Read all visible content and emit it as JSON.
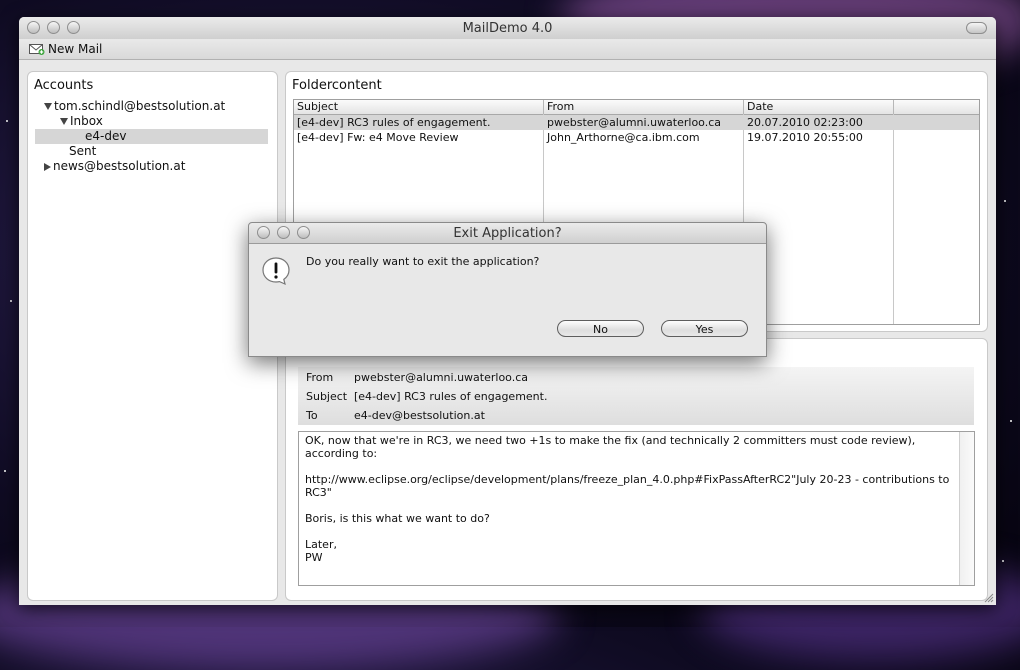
{
  "window": {
    "title": "MailDemo 4.0",
    "toolbar": {
      "new_mail_label": "New Mail",
      "new_mail_icon": "mail-add-icon"
    }
  },
  "accounts": {
    "title": "Accounts",
    "tree": [
      {
        "label": "tom.schindl@bestsolution.at",
        "expanded": true
      },
      {
        "label": "Inbox",
        "expanded": true
      },
      {
        "label": "e4-dev",
        "selected": true
      },
      {
        "label": "Sent"
      },
      {
        "label": "news@bestsolution.at",
        "expanded": false
      }
    ]
  },
  "foldercontent": {
    "title": "Foldercontent",
    "columns": [
      "Subject",
      "From",
      "Date"
    ],
    "rows": [
      {
        "subject": "[e4-dev] RC3 rules of engagement.",
        "from": "pwebster@alumni.uwaterloo.ca",
        "date": "20.07.2010 02:23:00",
        "selected": true
      },
      {
        "subject": "[e4-dev] Fw: e4 Move Review",
        "from": "John_Arthorne@ca.ibm.com",
        "date": "19.07.2010 20:55:00"
      }
    ]
  },
  "mail": {
    "from_label": "From",
    "from": "pwebster@alumni.uwaterloo.ca",
    "subject_label": "Subject",
    "subject": "[e4-dev] RC3 rules of engagement.",
    "to_label": "To",
    "to": "e4-dev@bestsolution.at",
    "body": "OK, now that we're in RC3, we need two +1s to make the fix (and technically 2 committers must code review), according to:\n\nhttp://www.eclipse.org/eclipse/development/plans/freeze_plan_4.0.php#FixPassAfterRC2\"July 20-23 - contributions to RC3\"\n\nBoris, is this what we want to do?\n\nLater,\nPW"
  },
  "dialog": {
    "title": "Exit Application?",
    "message": "Do you really want to exit the application?",
    "no_label": "No",
    "yes_label": "Yes",
    "icon": "warning-icon"
  }
}
